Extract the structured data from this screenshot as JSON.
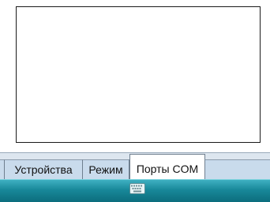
{
  "tabs": [
    {
      "label": "Устройства",
      "active": false
    },
    {
      "label": "Режим",
      "active": false
    },
    {
      "label": "Порты COM",
      "active": true
    }
  ],
  "taskbar": {
    "input_icon": "keyboard-icon"
  },
  "colors": {
    "tab_background": "#c9dbec",
    "active_tab_background": "#ffffff",
    "taskbar_top": "#3fb0c2",
    "taskbar_bottom": "#0c6d7d"
  }
}
